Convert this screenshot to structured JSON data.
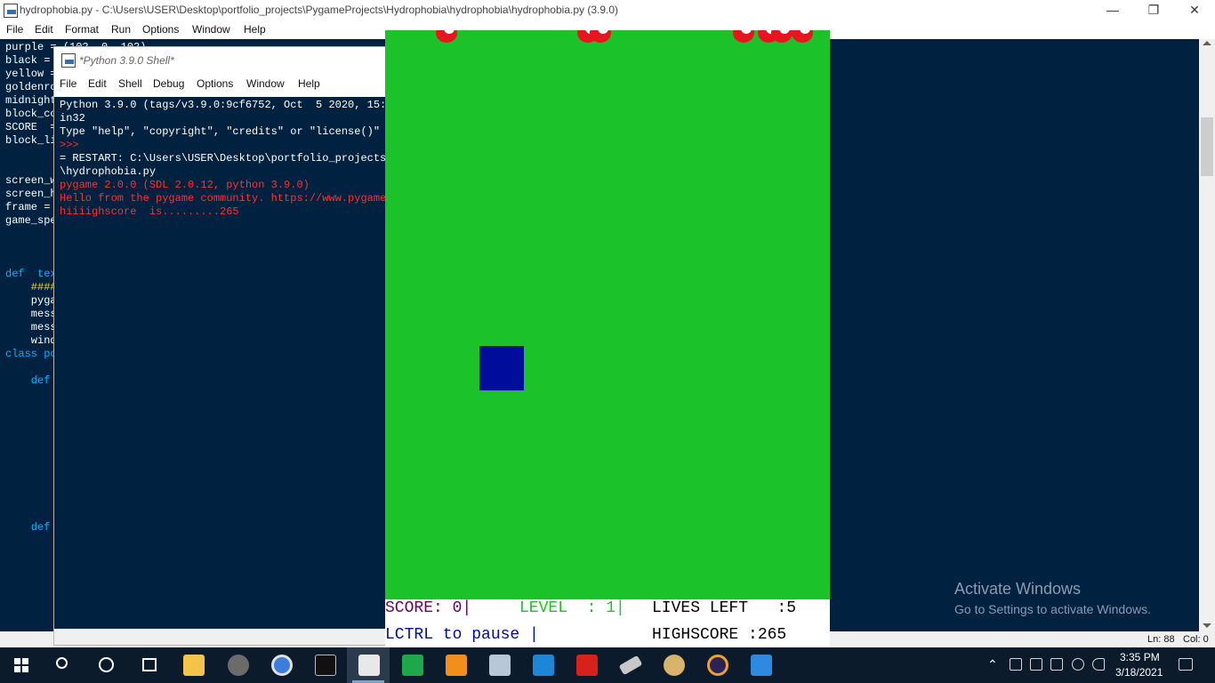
{
  "editor": {
    "title": "hydrophobia.py - C:\\Users\\USER\\Desktop\\portfolio_projects\\PygameProjects\\Hydrophobia\\hydrophobia\\hydrophobia.py (3.9.0)",
    "menu": [
      "File",
      "Edit",
      "Format",
      "Run",
      "Options",
      "Window",
      "Help"
    ],
    "code_lines": [
      "purple = (102, 0, 102)",
      "black =",
      "yellow =",
      "goldenro",
      "midnight",
      "block_co",
      "SCORE  =",
      "block_li",
      "",
      "",
      "screen_w",
      "screen_h",
      "frame =",
      "game_spe",
      "",
      "",
      "",
      "def  tex",
      "    ####",
      "    pyga",
      "    mess",
      "    mess",
      "    wind",
      "class po",
      "",
      "    def",
      "",
      "",
      "",
      "",
      "",
      "",
      "",
      "",
      "",
      "",
      "    def"
    ],
    "status": {
      "line": "Ln: 88",
      "col": "Col: 0"
    }
  },
  "shell": {
    "title": "*Python 3.9.0 Shell*",
    "menu": [
      "File",
      "Edit",
      "Shell",
      "Debug",
      "Options",
      "Window",
      "Help"
    ],
    "lines": [
      {
        "text": "Python 3.9.0 (tags/v3.9.0:9cf6752, Oct  5 2020, 15:34",
        "color": "white"
      },
      {
        "text": "in32",
        "color": "white"
      },
      {
        "text": "Type \"help\", \"copyright\", \"credits\" or \"license()\" fo",
        "color": "white"
      },
      {
        "text": ">>>",
        "color": "red"
      },
      {
        "text": "= RESTART: C:\\Users\\USER\\Desktop\\portfolio_projects\\P",
        "color": "white"
      },
      {
        "text": "\\hydrophobia.py",
        "color": "white"
      },
      {
        "text": "pygame 2.0.0 (SDL 2.0.12, python 3.9.0)",
        "color": "red"
      },
      {
        "text": "Hello from the pygame community. https://www.pygame.o",
        "color": "red"
      },
      {
        "text": "hiiiighscore  is.........265",
        "color": "red"
      }
    ]
  },
  "game": {
    "hud": {
      "score": "SCORE: 0|",
      "level": "LEVEL  : 1|",
      "lives": "LIVES LEFT   :5",
      "pause": "LCTRL to pause |",
      "highscore": "HIGHSCORE :265"
    },
    "colors": {
      "field": "#1bc22a",
      "player": "#000c9a",
      "ball": "#e8141e",
      "score_text": "#660066",
      "level_text": "#1bc22a"
    }
  },
  "watermark": {
    "title": "Activate Windows",
    "subtitle": "Go to Settings to activate Windows."
  },
  "taskbar": {
    "icons": [
      "windows-start-icon",
      "search-icon",
      "cortana-icon",
      "task-view-icon",
      "file-explorer-icon",
      "media-player-icon",
      "chrome-icon",
      "cmd-icon",
      "python-idle-icon",
      "pycharm-icon",
      "sublime-text-icon",
      "photos-icon",
      "vscode-icon",
      "acrobat-icon",
      "usb-icon",
      "paint-icon",
      "eclipse-icon",
      "photos-app-icon"
    ],
    "time": "3:35 PM",
    "date": "3/18/2021"
  }
}
